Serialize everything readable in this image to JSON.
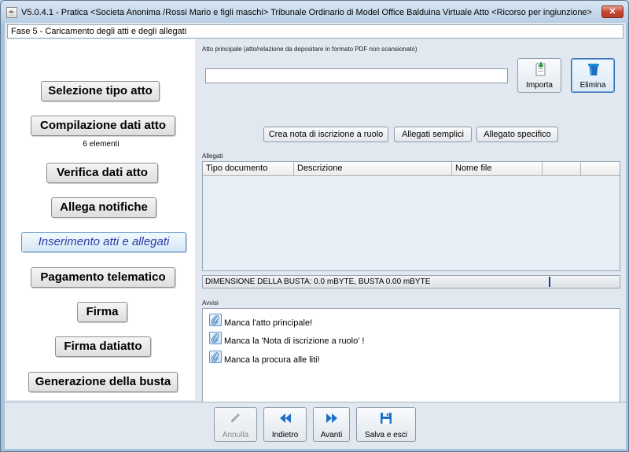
{
  "window": {
    "title": "V5.0.4.1 - Pratica <Societa Anonima /Rossi Mario e figli maschi>   Tribunale Ordinario di Model Office Balduina Virtuale   Atto <Ricorso per ingiunzione>",
    "close_label": "✕"
  },
  "phase": "Fase 5 - Caricamento degli atti e degli allegati",
  "steps": [
    {
      "label": "Selezione tipo atto"
    },
    {
      "label": "Compilazione dati atto",
      "sub": "6 elementi"
    },
    {
      "label": "Verifica dati atto"
    },
    {
      "label": "Allega notifiche"
    },
    {
      "label": "Inserimento atti e allegati",
      "active": true
    },
    {
      "label": "Pagamento telematico"
    },
    {
      "label": "Firma"
    },
    {
      "label": "Firma datiatto"
    },
    {
      "label": "Generazione della busta"
    }
  ],
  "main": {
    "atto_label": "Atto principale (atto/relazione da depositare in formato PDF non scansionato)",
    "atto_value": "",
    "importa_label": "Importa",
    "elimina_label": "Elimina",
    "crea_nota_label": "Crea nota di iscrizione a ruolo",
    "allegati_semplici_label": "Allegati semplici",
    "allegato_specifico_label": "Allegato specifico",
    "allegati_label": "Allegati",
    "columns": [
      "Tipo documento",
      "Descrizione",
      "Nome file",
      "",
      ""
    ],
    "busta_text": "DIMENSIONE DELLA BUSTA: 0.0 mBYTE, BUSTA 0.00 mBYTE",
    "avvisi_label": "Avvisi",
    "avvisi": [
      "Manca l'atto principale!",
      "Manca la 'Nota di iscrizione a ruolo' !",
      "Manca la procura alle liti!"
    ]
  },
  "nav": {
    "annulla": "Annulla",
    "indietro": "Indietro",
    "avanti": "Avanti",
    "salva": "Salva e esci"
  },
  "colors": {
    "accent": "#1f6fc4",
    "active_step_text": "#2a3aa8"
  }
}
